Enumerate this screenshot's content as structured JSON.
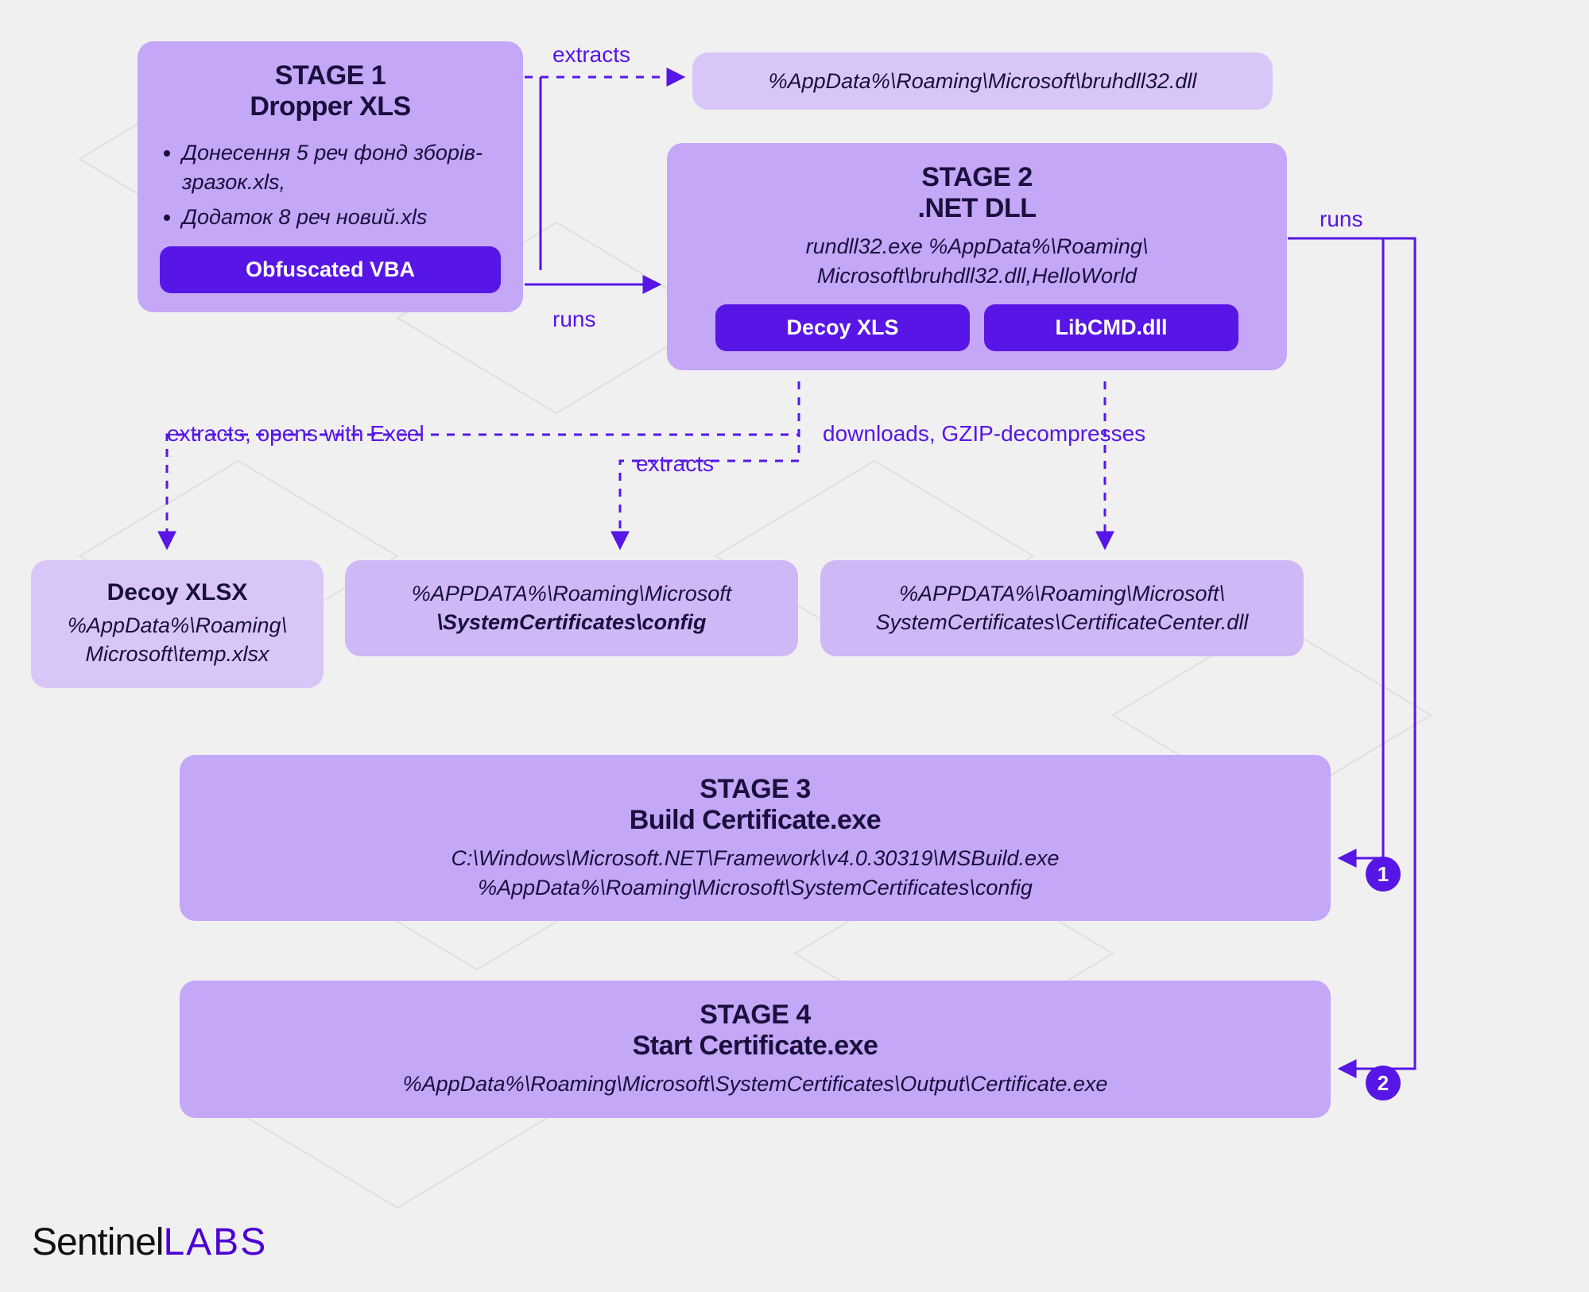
{
  "stage1": {
    "title_line1": "STAGE 1",
    "title_line2": "Dropper XLS",
    "bullets": [
      "Донесення 5 реч фонд зборів- зразок.xls,",
      "Додаток 8 реч новий.xls"
    ],
    "pill": "Obfuscated VBA"
  },
  "stage2": {
    "title_line1": "STAGE 2",
    "title_line2": ".NET DLL",
    "body_line1": "rundll32.exe %AppData%\\Roaming\\",
    "body_line2": "Microsoft\\bruhdll32.dll,HelloWorld",
    "pill1": "Decoy XLS",
    "pill2": "LibCMD.dll"
  },
  "stage3": {
    "title_line1": "STAGE 3",
    "title_line2": "Build Certificate.exe",
    "body_line1": "C:\\Windows\\Microsoft.NET\\Framework\\v4.0.30319\\MSBuild.exe",
    "body_line2": "%AppData%\\Roaming\\Microsoft\\SystemCertificates\\config"
  },
  "stage4": {
    "title_line1": "STAGE 4",
    "title_line2": "Start Certificate.exe",
    "body": "%AppData%\\Roaming\\Microsoft\\SystemCertificates\\Output\\Certificate.exe"
  },
  "paths": {
    "bruh": "%AppData%\\Roaming\\Microsoft\\bruhdll32.dll",
    "decoy_title": "Decoy XLSX",
    "decoy_line1": "%AppData%\\Roaming\\",
    "decoy_line2": "Microsoft\\temp.xlsx",
    "config_line1": "%APPDATA%\\Roaming\\Microsoft",
    "config_line2": "\\SystemCertificates\\config",
    "cert_line1": "%APPDATA%\\Roaming\\Microsoft\\",
    "cert_line2": "SystemCertificates\\CertificateCenter.dll"
  },
  "labels": {
    "extracts_top": "extracts",
    "runs1": "runs",
    "runs2": "runs",
    "extracts_opens": "extracts, opens with Excel",
    "extracts_mid": "extracts",
    "downloads": "downloads, GZIP-decompresses",
    "n1": "1",
    "n2": "2"
  },
  "logo": {
    "brand": "Sentinel",
    "labs": "LABS"
  }
}
